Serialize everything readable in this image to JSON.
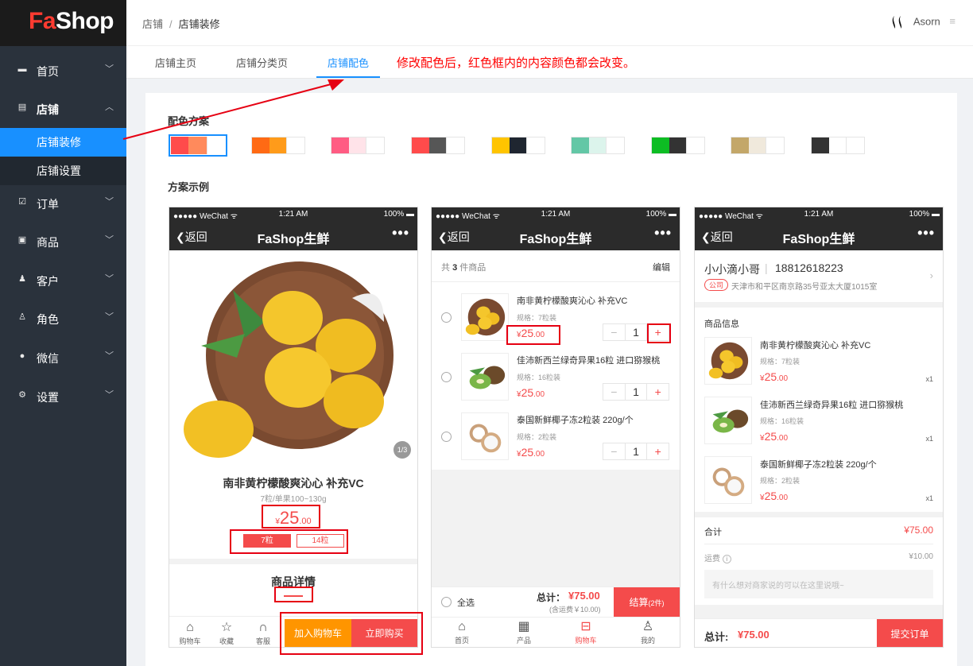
{
  "app": {
    "logo_fa": "Fa",
    "logo_shop": "Shop"
  },
  "sidebar": {
    "items": [
      {
        "label": "首页",
        "icon": "monitor-icon"
      },
      {
        "label": "店铺",
        "icon": "store-icon"
      },
      {
        "label": "订单",
        "icon": "order-icon"
      },
      {
        "label": "商品",
        "icon": "goods-icon"
      },
      {
        "label": "客户",
        "icon": "customer-icon"
      },
      {
        "label": "角色",
        "icon": "role-icon"
      },
      {
        "label": "微信",
        "icon": "wechat-icon"
      },
      {
        "label": "设置",
        "icon": "gear-icon"
      }
    ],
    "sub_items": [
      {
        "label": "店铺装修",
        "active": true
      },
      {
        "label": "店铺设置",
        "active": false
      }
    ]
  },
  "header": {
    "crumb_1": "店铺",
    "crumb_sep": "/",
    "crumb_2": "店铺装修",
    "user": "Asorn",
    "user_menu_icon": "≡"
  },
  "tabs": {
    "items": [
      "店铺主页",
      "店铺分类页",
      "店铺配色"
    ],
    "active": 2,
    "note": "修改配色后，红色框内的内容颜色都会改变。"
  },
  "content": {
    "scheme_title": "配色方案",
    "example_title": "方案示例",
    "swatches": [
      [
        "#ff4b4b",
        "#ff8a5c",
        "#ffffff"
      ],
      [
        "#ff6a14",
        "#ff9b1a",
        "#ffffff"
      ],
      [
        "#ff5c83",
        "#ffe3e9",
        "#ffffff"
      ],
      [
        "#ff4b4b",
        "#565656",
        "#ffffff"
      ],
      [
        "#ffc400",
        "#1f2630",
        "#ffffff"
      ],
      [
        "#63c7a6",
        "#dcf4ec",
        "#ffffff"
      ],
      [
        "#0dbd23",
        "#333333",
        "#ffffff"
      ],
      [
        "#c3a769",
        "#f0e9dc",
        "#ffffff"
      ],
      [
        "#333333",
        "#ffffff",
        "#ffffff"
      ]
    ]
  },
  "phone": {
    "status_left": "●●●●● WeChat ᯤ",
    "status_time": "1:21 AM",
    "status_right": "100% ▬",
    "back": "返回",
    "title": "FaShop生鲜",
    "more": "•••"
  },
  "product_page": {
    "image_counter": "1/3",
    "name": "南非黄柠檬酸爽沁心 补充VC",
    "spec": "7粒/单果100~130g",
    "price_symbol": "¥",
    "price_int": "25",
    "price_dec": ".00",
    "options": [
      "7粒",
      "14粒"
    ],
    "detail_title": "商品详情",
    "bottom_tabs": [
      "购物车",
      "收藏",
      "客服"
    ],
    "add_cart": "加入购物车",
    "buy_now": "立即购买"
  },
  "cart_page": {
    "count_prefix": "共",
    "count": "3",
    "count_suffix": "件商品",
    "edit": "编辑",
    "items": [
      {
        "name": "南非黄柠檬酸爽沁心 补充VC",
        "spec": "规格：7粒装",
        "price_int": "25",
        "price_dec": ".00",
        "qty": "1"
      },
      {
        "name": "佳沛新西兰绿奇异果16粒 进口猕猴桃",
        "spec": "规格：16粒装",
        "price_int": "25",
        "price_dec": ".00",
        "qty": "1"
      },
      {
        "name": "泰国新鲜椰子冻2粒装  220g/个",
        "spec": "规格：2粒装",
        "price_int": "25",
        "price_dec": ".00",
        "qty": "1"
      }
    ],
    "minus": "−",
    "plus": "+",
    "select_all": "全选",
    "total_label": "总计：",
    "total": "¥75.00",
    "shipping_note": "(含运费￥10.00)",
    "checkout": "结算",
    "checkout_count": "(2件)",
    "bottom_tabs": [
      "首页",
      "产品",
      "购物车",
      "我的"
    ]
  },
  "order_page": {
    "recipient": "小小滴小哥",
    "phone": "18812618223",
    "addr_tag": "公司",
    "address": "天津市和平区南京路35号亚太大厦1015室",
    "goods_title": "商品信息",
    "items": [
      {
        "name": "南非黄柠檬酸爽沁心 补充VC",
        "spec": "规格：7粒装",
        "price_int": "25",
        "price_dec": ".00",
        "qty": "x1"
      },
      {
        "name": "佳沛新西兰绿奇异果16粒 进口猕猴桃",
        "spec": "规格：16粒装",
        "price_int": "25",
        "price_dec": ".00",
        "qty": "x1"
      },
      {
        "name": "泰国新鲜椰子冻2粒装  220g/个",
        "spec": "规格：2粒装",
        "price_int": "25",
        "price_dec": ".00",
        "qty": "x1"
      }
    ],
    "subtotal_label": "合计",
    "subtotal": "¥75.00",
    "freight_label": "运费",
    "freight": "¥10.00",
    "message_placeholder": "有什么想对商家说的可以在这里说哦~",
    "total_label": "总计:",
    "total": "¥75.00",
    "submit": "提交订单"
  },
  "colors": {
    "accent": "#1890ff",
    "brand_red": "#f44b4b",
    "sidebar": "#2a323c",
    "annotation_red": "#ff0000"
  }
}
